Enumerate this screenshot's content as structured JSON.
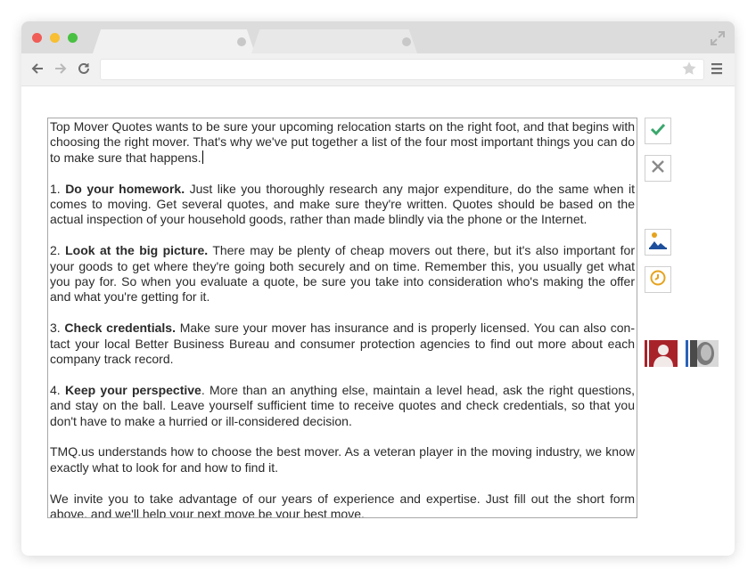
{
  "editor": {
    "intro": "Top Mover Quotes wants to be sure your upcoming relocation starts on the right foot, and that begins with choosing the right mover. That's why we've put together a list of the four most important things you can do to make sure that happens.",
    "items": [
      {
        "number": "1.",
        "heading": "Do your homework.",
        "body": "Just like you thoroughly research any major expenditure, do the same when it comes to moving. Get several quotes, and make sure they're written. Quotes should be based on the actual inspection of your household goods, rather than made blindly via the phone or the Internet."
      },
      {
        "number": "2.",
        "heading": "Look at the big picture.",
        "body": "There may be plenty of cheap movers out there, but it's also important for your goods to get where they're going both securely and on time. Remember this, you usually get what you pay for. So when you evaluate a quote, be sure you take into consideration who's making the offer and what you're getting for it."
      },
      {
        "number": "3.",
        "heading": "Check credentials.",
        "body": "Make sure your mover has insurance and is properly licensed. You can also con-tact your local Better Business Bureau and consumer protection agencies to find out more about each company track record."
      },
      {
        "number": "4.",
        "heading": "Keep your perspective",
        "body": ". More than an anything else, maintain a level head, ask the right questions, and stay on the ball. Leave yourself sufficient time to receive quotes and check credentials, so that you don't have to make a hurried or ill-considered decision."
      }
    ],
    "para_tmq": "TMQ.us understands how to choose the best mover. As a veteran player in the moving industry, we know exactly what to look for and how to find it.",
    "para_invite": "We invite you to take advantage of our years of experience and expertise. Just fill out the short form above, and we'll help your next move be your best move."
  },
  "icons": {
    "confirm": "check-icon",
    "cancel": "close-icon",
    "image": "image-icon",
    "history": "clock-icon",
    "avatar1": "user-avatar-red",
    "avatar2": "user-avatar-photo"
  },
  "colors": {
    "check": "#3aa76d",
    "close": "#8a8a8a",
    "image_accent": "#1e4f9c",
    "clock": "#e6a31e",
    "avatar_red": "#a8222a",
    "avatar_blue": "#2a62b8"
  }
}
